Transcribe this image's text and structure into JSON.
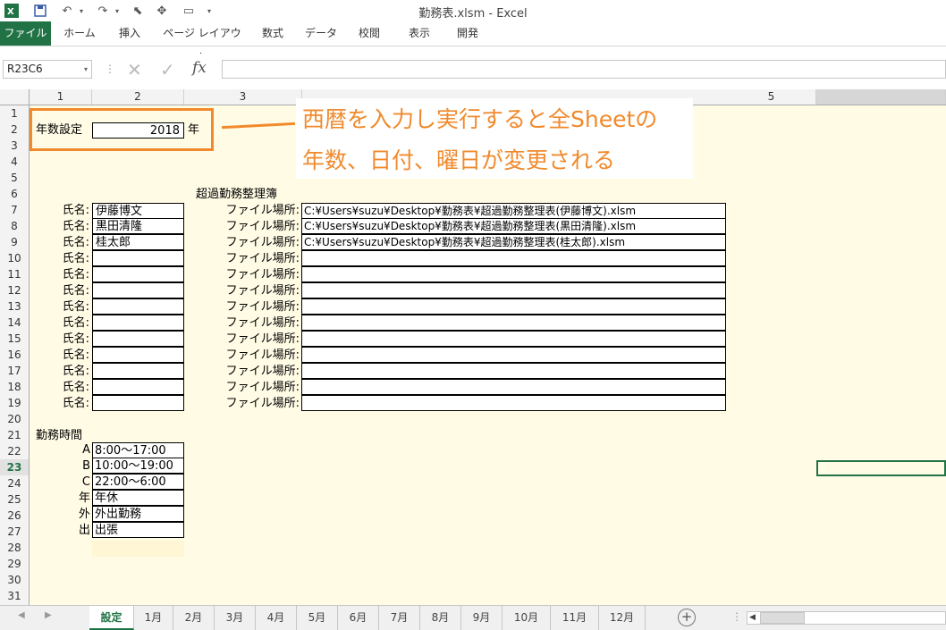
{
  "window": {
    "title": "勤務表.xlsm - Excel",
    "app_icon": "excel-icon"
  },
  "ribbon": {
    "tabs": [
      "ファイル",
      "ホーム",
      "挿入",
      "ページ レイアウト",
      "数式",
      "データ",
      "校閲",
      "表示",
      "開発"
    ]
  },
  "formula_bar": {
    "name_box": "R23C6",
    "fx": "fx",
    "value": ""
  },
  "columns": [
    "1",
    "2",
    "3",
    "5"
  ],
  "rows": [
    "1",
    "2",
    "3",
    "4",
    "5",
    "6",
    "7",
    "8",
    "9",
    "10",
    "11",
    "12",
    "13",
    "14",
    "15",
    "16",
    "17",
    "18",
    "19",
    "20",
    "21",
    "22",
    "23",
    "24",
    "25",
    "26",
    "27",
    "28",
    "29",
    "30",
    "31"
  ],
  "selected_row": "23",
  "sheet": {
    "year_label": "年数設定",
    "year_value": "2018",
    "year_unit": "年",
    "overtime_header": "超過勤務整理簿",
    "name_label": "氏名:",
    "file_label": "ファイル場所:",
    "employees": [
      {
        "name": "伊藤博文",
        "path": "C:¥Users¥suzu¥Desktop¥勤務表¥超過勤務整理表(伊藤博文).xlsm"
      },
      {
        "name": "黒田清隆",
        "path": "C:¥Users¥suzu¥Desktop¥勤務表¥超過勤務整理表(黒田清隆).xlsm"
      },
      {
        "name": "桂太郎",
        "path": "C:¥Users¥suzu¥Desktop¥勤務表¥超過勤務整理表(桂太郎).xlsm"
      },
      {
        "name": "",
        "path": ""
      },
      {
        "name": "",
        "path": ""
      },
      {
        "name": "",
        "path": ""
      },
      {
        "name": "",
        "path": ""
      },
      {
        "name": "",
        "path": ""
      },
      {
        "name": "",
        "path": ""
      },
      {
        "name": "",
        "path": ""
      },
      {
        "name": "",
        "path": ""
      },
      {
        "name": "",
        "path": ""
      },
      {
        "name": "",
        "path": ""
      }
    ],
    "hours_header": "勤務時間",
    "hours": [
      {
        "code": "A",
        "value": "8:00～17:00"
      },
      {
        "code": "B",
        "value": "10:00～19:00"
      },
      {
        "code": "C",
        "value": "22:00～6:00"
      },
      {
        "code": "年",
        "value": "年休"
      },
      {
        "code": "外",
        "value": "外出勤務"
      },
      {
        "code": "出",
        "value": "出張"
      }
    ]
  },
  "annotation": {
    "line1": "西暦を入力し実行すると全Sheetの",
    "line2": "年数、日付、曜日が変更される",
    "color": "#f08a2c"
  },
  "sheet_tabs": [
    "設定",
    "1月",
    "2月",
    "3月",
    "4月",
    "5月",
    "6月",
    "7月",
    "8月",
    "9月",
    "10月",
    "11月",
    "12月"
  ],
  "active_tab": "設定"
}
